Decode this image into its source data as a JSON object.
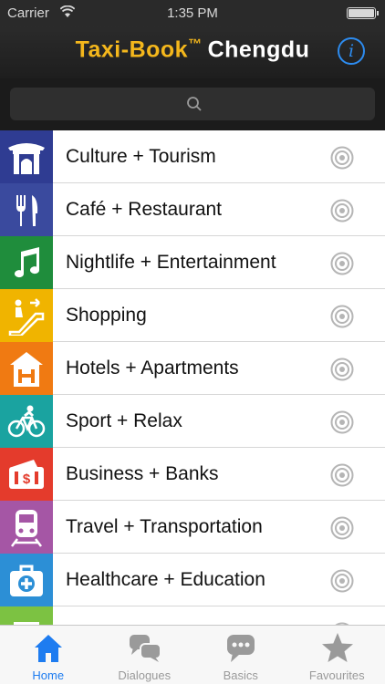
{
  "status_bar": {
    "carrier": "Carrier",
    "time": "1:35 PM",
    "battery_level": 1.0
  },
  "nav": {
    "brand": "Taxi-Book",
    "trademark": "™",
    "city": "Chengdu",
    "info_icon": "info-icon"
  },
  "search": {
    "placeholder": "",
    "icon": "search-icon"
  },
  "categories": [
    {
      "label": "Culture + Tourism",
      "color": "#2f3c92",
      "icon": "temple-icon"
    },
    {
      "label": "Café + Restaurant",
      "color": "#3a4a9e",
      "icon": "fork-knife-icon"
    },
    {
      "label": "Nightlife + Entertainment",
      "color": "#1f8d3c",
      "icon": "music-note-icon"
    },
    {
      "label": "Shopping",
      "color": "#f0b400",
      "icon": "escalator-icon"
    },
    {
      "label": "Hotels + Apartments",
      "color": "#f07a12",
      "icon": "hotel-icon"
    },
    {
      "label": "Sport + Relax",
      "color": "#1aa3a0",
      "icon": "bicycle-icon"
    },
    {
      "label": "Business + Banks",
      "color": "#e43b2c",
      "icon": "money-icon"
    },
    {
      "label": "Travel + Transportation",
      "color": "#a556a5",
      "icon": "train-icon"
    },
    {
      "label": "Healthcare + Education",
      "color": "#2c8fd6",
      "icon": "medical-kit-icon"
    },
    {
      "label": "",
      "color": "#7cc242",
      "icon": "more-icon"
    }
  ],
  "tabs": [
    {
      "label": "Home",
      "icon": "home-icon",
      "active": true
    },
    {
      "label": "Dialogues",
      "icon": "chat-bubbles-icon",
      "active": false
    },
    {
      "label": "Basics",
      "icon": "speech-bubble-icon",
      "active": false
    },
    {
      "label": "Favourites",
      "icon": "star-icon",
      "active": false
    }
  ],
  "colors": {
    "brand_yellow": "#f4b71c",
    "accent_blue": "#1e7cf0",
    "nav_dark": "#1e1e1e"
  }
}
